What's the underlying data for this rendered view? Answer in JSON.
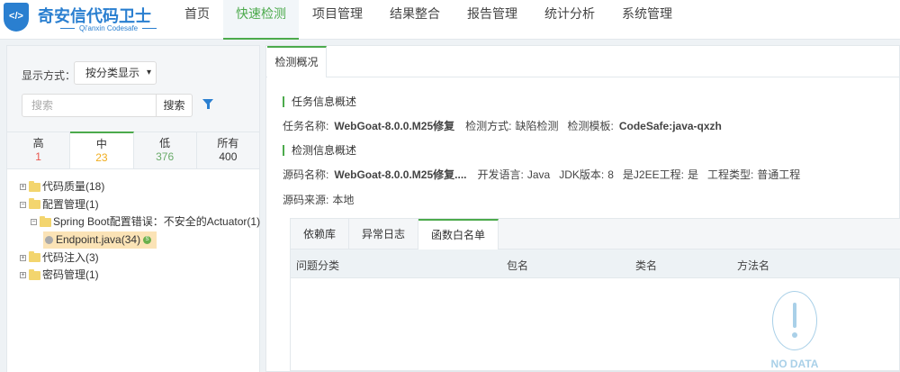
{
  "header": {
    "logo_title": "奇安信代码卫士",
    "logo_subtitle": "Qi'anxin Codesafe",
    "nav": [
      "首页",
      "快速检测",
      "项目管理",
      "结果整合",
      "报告管理",
      "统计分析",
      "系统管理"
    ],
    "active_nav": "快速检测"
  },
  "left": {
    "display_label": "显示方式：",
    "display_value": "按分类显示",
    "search_placeholder": "搜索",
    "search_button": "搜索",
    "severity": [
      {
        "label": "高",
        "count": "1",
        "color": "#e8554e"
      },
      {
        "label": "中",
        "count": "23",
        "color": "#f0ad1e"
      },
      {
        "label": "低",
        "count": "376",
        "color": "#6aab6a"
      },
      {
        "label": "所有",
        "count": "400",
        "color": "#333333"
      }
    ],
    "tree": [
      "代码质量(18)",
      "配置管理(1)",
      "Spring Boot配置错误：不安全的Actuator(1)",
      "Endpoint.java(34)",
      "代码注入(3)",
      "密码管理(1)"
    ],
    "badge": "S"
  },
  "right": {
    "tab": "检测概况",
    "task_section": "任务信息概述",
    "task_name_label": "任务名称:",
    "task_name": "WebGoat-8.0.0.M25修复",
    "detect_mode_label": "检测方式:",
    "detect_mode": "缺陷检测",
    "template_label": "检测模板:",
    "template": "CodeSafe:java-qxzh",
    "detect_section": "检测信息概述",
    "src_name_label": "源码名称:",
    "src_name": "WebGoat-8.0.0.M25修复....",
    "lang_label": "开发语言:",
    "lang": "Java",
    "jdk_label": "JDK版本:",
    "jdk": "8",
    "j2ee_label": "是J2EE工程:",
    "j2ee": "是",
    "proj_type_label": "工程类型:",
    "proj_type": "普通工程",
    "src_from_label": "源码来源:",
    "src_from": "本地",
    "inner_tabs": [
      "依赖库",
      "异常日志",
      "函数白名单"
    ],
    "columns": [
      "问题分类",
      "包名",
      "类名",
      "方法名"
    ],
    "no_data": "NO DATA"
  }
}
